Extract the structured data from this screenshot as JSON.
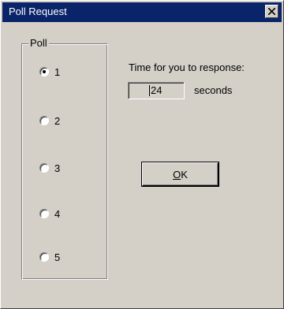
{
  "window": {
    "title": "Poll Request",
    "close_icon": "close-icon"
  },
  "poll": {
    "group_label": "Poll",
    "options": [
      {
        "label": "1",
        "selected": true
      },
      {
        "label": "2",
        "selected": false
      },
      {
        "label": "3",
        "selected": false
      },
      {
        "label": "4",
        "selected": false
      },
      {
        "label": "5",
        "selected": false
      }
    ]
  },
  "timer": {
    "label": "Time for you to response:",
    "value": "24",
    "unit": "seconds"
  },
  "ok_button": {
    "accel": "O",
    "rest": "K"
  },
  "colors": {
    "title_bar": "#0a246a",
    "face": "#d4d0c8"
  }
}
